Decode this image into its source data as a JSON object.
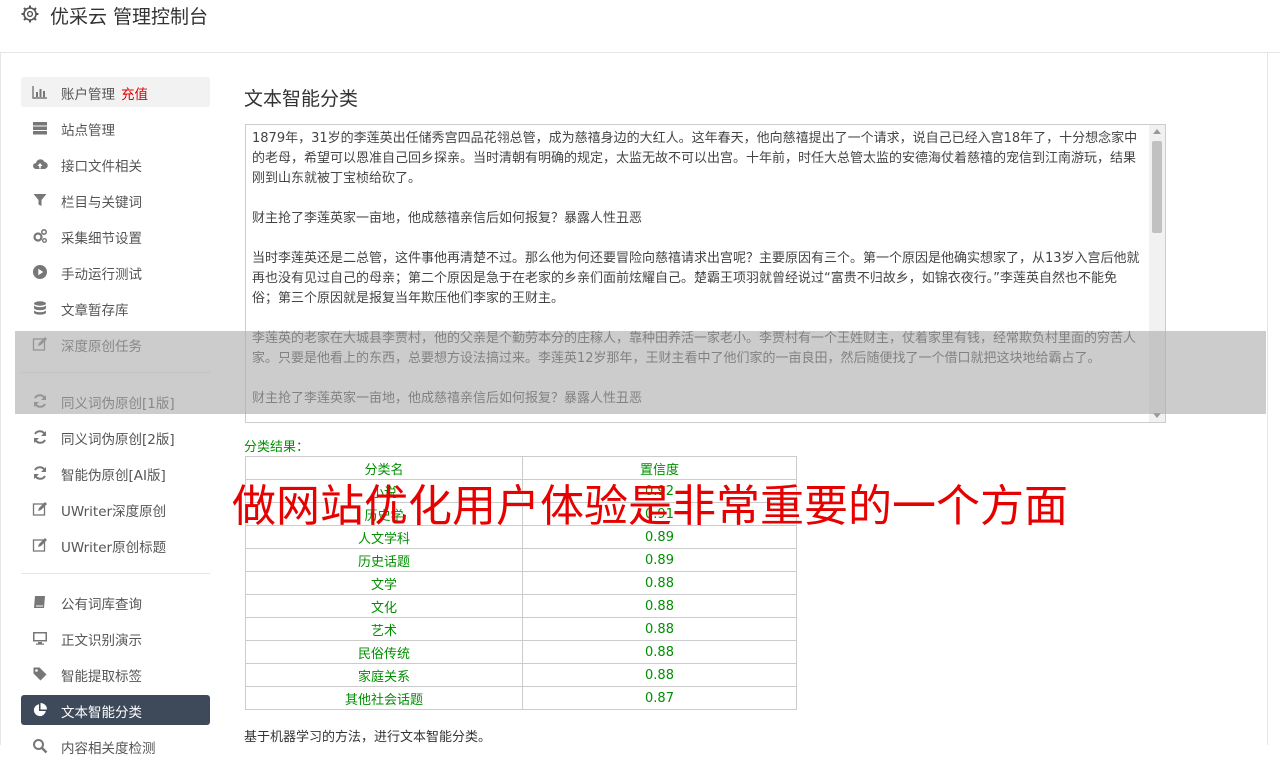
{
  "header": {
    "title": "优采云 管理控制台",
    "icon": "gear-icon"
  },
  "sidebar": {
    "items": [
      {
        "label": "账户管理",
        "extra": "充值",
        "icon": "bar-chart-icon"
      },
      {
        "label": "站点管理",
        "icon": "server-icon"
      },
      {
        "label": "接口文件相关",
        "icon": "cloud-upload-icon"
      },
      {
        "label": "栏目与关键词",
        "icon": "filter-icon"
      },
      {
        "label": "采集细节设置",
        "icon": "gears-icon"
      },
      {
        "label": "手动运行测试",
        "icon": "play-circle-icon"
      },
      {
        "label": "文章暂存库",
        "icon": "database-icon"
      },
      {
        "label": "深度原创任务",
        "icon": "edit-icon"
      },
      {
        "label": "同义词伪原创[1版]",
        "icon": "refresh-icon"
      },
      {
        "label": "同义词伪原创[2版]",
        "icon": "refresh-icon"
      },
      {
        "label": "智能伪原创[AI版]",
        "icon": "refresh-icon"
      },
      {
        "label": "UWriter深度原创",
        "icon": "edit-icon"
      },
      {
        "label": "UWriter原创标题",
        "icon": "edit-icon"
      },
      {
        "label": "公有词库查询",
        "icon": "book-icon"
      },
      {
        "label": "正文识别演示",
        "icon": "monitor-icon"
      },
      {
        "label": "智能提取标签",
        "icon": "tag-icon"
      },
      {
        "label": "文本智能分类",
        "icon": "pie-chart-icon"
      },
      {
        "label": "内容相关度检测",
        "icon": "search-icon"
      }
    ]
  },
  "main": {
    "title": "文本智能分类",
    "text_paragraphs": [
      "1879年，31岁的李莲英出任储秀宫四品花翎总管，成为慈禧身边的大红人。这年春天，他向慈禧提出了一个请求，说自己已经入宫18年了，十分想念家中的老母，希望可以恩准自己回乡探亲。当时清朝有明确的规定，太监无故不可以出宫。十年前，时任大总管太监的安德海仗着慈禧的宠信到江南游玩，结果刚到山东就被丁宝桢给砍了。",
      "财主抢了李莲英家一亩地，他成慈禧亲信后如何报复？暴露人性丑恶",
      "当时李莲英还是二总管，这件事他再清楚不过。那么他为何还要冒险向慈禧请求出宫呢？主要原因有三个。第一个原因是他确实想家了，从13岁入宫后他就再也没有见过自己的母亲；第二个原因是急于在老家的乡亲们面前炫耀自己。楚霸王项羽就曾经说过“富贵不归故乡，如锦衣夜行。”李莲英自然也不能免俗；第三个原因就是报复当年欺压他们李家的王财主。",
      "李莲英的老家在大城县李贾村，他的父亲是个勤劳本分的庄稼人，靠种田养活一家老小。李贾村有一个王姓财主，仗着家里有钱，经常欺负村里面的穷苦人家。只要是他看上的东西，总要想方设法搞过来。李莲英12岁那年，王财主看中了他们家的一亩良田，然后随便找了一个借口就把这块地给霸占了。",
      "财主抢了李莲英家一亩地，他成慈禧亲信后如何报复？暴露人性丑恶"
    ],
    "result_label": "分类结果：",
    "table": {
      "headers": [
        "分类名",
        "置信度"
      ],
      "rows": [
        [
          "小说",
          "0.92"
        ],
        [
          "历史学",
          "0.91"
        ],
        [
          "人文学科",
          "0.89"
        ],
        [
          "历史话题",
          "0.89"
        ],
        [
          "文学",
          "0.88"
        ],
        [
          "文化",
          "0.88"
        ],
        [
          "艺术",
          "0.88"
        ],
        [
          "民俗传统",
          "0.88"
        ],
        [
          "家庭关系",
          "0.88"
        ],
        [
          "其他社会话题",
          "0.87"
        ]
      ]
    },
    "footnote": "基于机器学习的方法，进行文本智能分类。"
  },
  "overlay": {
    "watermark": "做网站优化用户体验是非常重要的一个方面"
  },
  "colors": {
    "accent_green": "#009000",
    "active_nav": "#3e4a5a",
    "charge_red": "#e00000",
    "watermark_red": "#e60000"
  }
}
